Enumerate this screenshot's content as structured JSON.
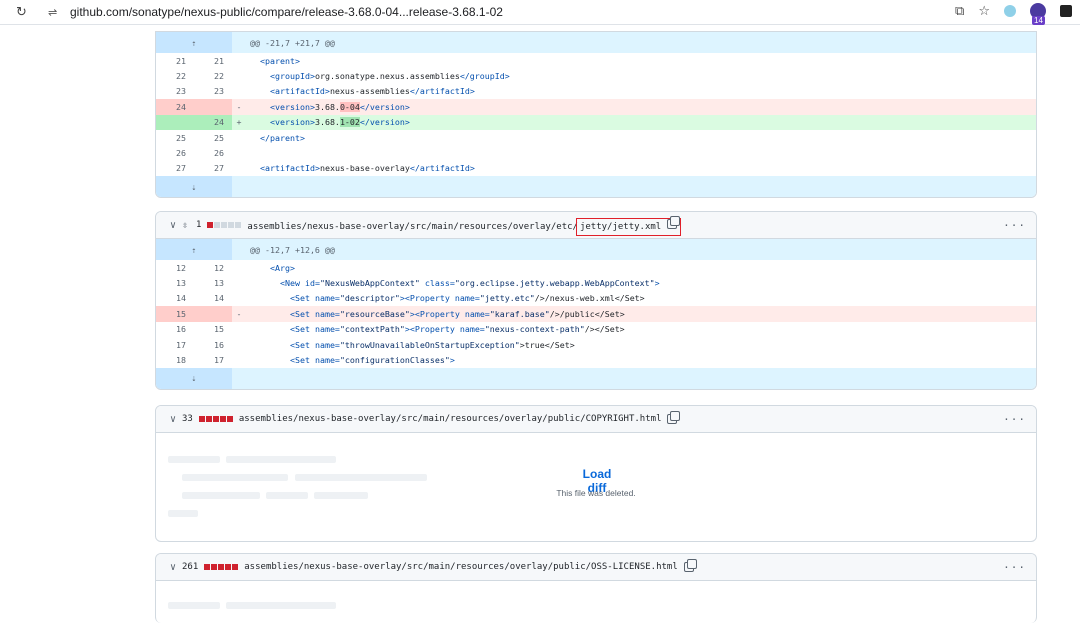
{
  "browser": {
    "url": "github.com/sonatype/nexus-public/compare/release-3.68.0-04...release-3.68.1-02",
    "ext_badge": "14"
  },
  "file1": {
    "hunk_header": "@@ -21,7 +21,7 @@",
    "lines": [
      {
        "old": "21",
        "new": "21",
        "sign": "",
        "type": "ctx"
      },
      {
        "old": "22",
        "new": "22",
        "sign": "",
        "type": "ctx"
      },
      {
        "old": "23",
        "new": "23",
        "sign": "",
        "type": "ctx"
      },
      {
        "old": "24",
        "new": "",
        "sign": "-",
        "type": "del"
      },
      {
        "old": "",
        "new": "24",
        "sign": "+",
        "type": "add"
      },
      {
        "old": "25",
        "new": "25",
        "sign": "",
        "type": "ctx"
      },
      {
        "old": "26",
        "new": "26",
        "sign": "",
        "type": "ctx"
      },
      {
        "old": "27",
        "new": "27",
        "sign": "",
        "type": "ctx"
      }
    ],
    "code": {
      "l0_tag": "<parent>",
      "l1_open": "<groupId>",
      "l1_text": "org.sonatype.nexus.assemblies",
      "l1_close": "</groupId>",
      "l2_open": "<artifactId>",
      "l2_text": "nexus-assemblies",
      "l2_close": "</artifactId>",
      "l3_open": "<version>",
      "l3_pre": "3.68.",
      "l3_hl": "0-04",
      "l3_close": "</version>",
      "l4_open": "<version>",
      "l4_pre": "3.68.",
      "l4_hl": "1-02",
      "l4_close": "</version>",
      "l5_tag": "</parent>",
      "l7_open": "<artifactId>",
      "l7_text": "nexus-base-overlay",
      "l7_close": "</artifactId>"
    }
  },
  "file2": {
    "count": "1",
    "path_pre": "assemblies/nexus-base-overlay/src/main/resources/overlay/etc/",
    "path_hl": "jetty/jetty.xml",
    "hunk_header": "@@ -12,7 +12,6 @@",
    "lines": [
      {
        "old": "12",
        "new": "12",
        "sign": "",
        "type": "ctx"
      },
      {
        "old": "13",
        "new": "13",
        "sign": "",
        "type": "ctx"
      },
      {
        "old": "14",
        "new": "14",
        "sign": "",
        "type": "ctx"
      },
      {
        "old": "15",
        "new": "",
        "sign": "-",
        "type": "del"
      },
      {
        "old": "16",
        "new": "15",
        "sign": "",
        "type": "ctx"
      },
      {
        "old": "17",
        "new": "16",
        "sign": "",
        "type": "ctx"
      },
      {
        "old": "18",
        "new": "17",
        "sign": "",
        "type": "ctx"
      }
    ],
    "code": {
      "l0": "<Arg>",
      "l1_a": "<New ",
      "l1_b": "id=",
      "l1_c": "\"NexusWebAppContext\"",
      "l1_d": " class=",
      "l1_e": "\"org.eclipse.jetty.webapp.WebAppContext\"",
      "l1_f": ">",
      "l2_a": "<Set ",
      "l2_b": "name=",
      "l2_c": "\"descriptor\"",
      "l2_d": "><Property ",
      "l2_e": "name=",
      "l2_f": "\"jetty.etc\"",
      "l2_g": "/>/nexus-web.xml</Set>",
      "l3_a": "<Set ",
      "l3_b": "name=",
      "l3_c": "\"resourceBase\"",
      "l3_d": "><Property ",
      "l3_e": "name=",
      "l3_f": "\"karaf.base\"",
      "l3_g": "/>/public</Set>",
      "l4_a": "<Set ",
      "l4_b": "name=",
      "l4_c": "\"contextPath\"",
      "l4_d": "><Property ",
      "l4_e": "name=",
      "l4_f": "\"nexus-context-path\"",
      "l4_g": "/></Set>",
      "l5_a": "<Set ",
      "l5_b": "name=",
      "l5_c": "\"throwUnavailableOnStartupException\"",
      "l5_d": ">true</Set>",
      "l6_a": "<Set ",
      "l6_b": "name=",
      "l6_c": "\"configurationClasses\"",
      "l6_d": ">"
    }
  },
  "file3": {
    "count": "33",
    "path": "assemblies/nexus-base-overlay/src/main/resources/overlay/public/COPYRIGHT.html",
    "load_label": "Load diff",
    "note": "This file was deleted."
  },
  "file4": {
    "count": "261",
    "path": "assemblies/nexus-base-overlay/src/main/resources/overlay/public/OSS-LICENSE.html"
  },
  "icons": {
    "kebab": "···",
    "expand_up": "⇡",
    "expand_down": "⇣",
    "chevron": "∨"
  }
}
